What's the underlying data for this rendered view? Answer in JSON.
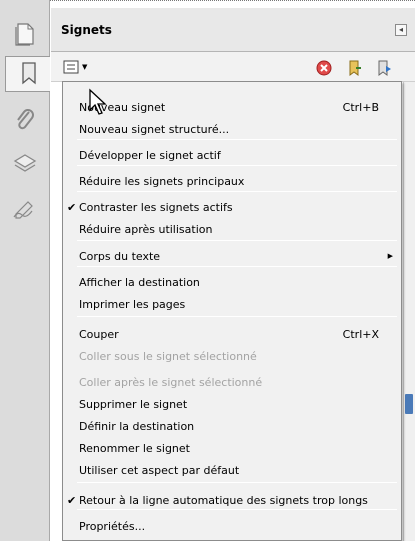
{
  "panel": {
    "title": "Signets"
  },
  "rail": {
    "icons": [
      "pages-icon",
      "bookmarks-icon",
      "attachments-icon",
      "layers-icon",
      "signatures-icon"
    ]
  },
  "toolbar": {
    "options_icon": "options-menu-icon",
    "delete_icon": "delete-icon",
    "new_bookmark_icon": "new-bookmark-icon",
    "expand_icon": "expand-bookmark-icon"
  },
  "menu": {
    "items": [
      {
        "label": "Nouveau signet",
        "shortcut": "Ctrl+B",
        "checked": false,
        "disabled": false,
        "submenu": false
      },
      {
        "label": "Nouveau signet structuré...",
        "shortcut": "",
        "checked": false,
        "disabled": false,
        "submenu": false
      },
      {
        "label": "Développer le signet actif",
        "shortcut": "",
        "checked": false,
        "disabled": false,
        "submenu": false
      },
      {
        "label": "Réduire les signets principaux",
        "shortcut": "",
        "checked": false,
        "disabled": false,
        "submenu": false
      },
      {
        "label": "Contraster les signets actifs",
        "shortcut": "",
        "checked": true,
        "disabled": false,
        "submenu": false
      },
      {
        "label": "Réduire après utilisation",
        "shortcut": "",
        "checked": false,
        "disabled": false,
        "submenu": false
      },
      {
        "label": "Corps du texte",
        "shortcut": "",
        "checked": false,
        "disabled": false,
        "submenu": true
      },
      {
        "label": "Afficher la destination",
        "shortcut": "",
        "checked": false,
        "disabled": false,
        "submenu": false
      },
      {
        "label": "Imprimer les pages",
        "shortcut": "",
        "checked": false,
        "disabled": false,
        "submenu": false
      },
      {
        "label": "Couper",
        "shortcut": "Ctrl+X",
        "checked": false,
        "disabled": false,
        "submenu": false
      },
      {
        "label": "Coller sous le signet sélectionné",
        "shortcut": "",
        "checked": false,
        "disabled": true,
        "submenu": false
      },
      {
        "label": "Coller après le signet sélectionné",
        "shortcut": "",
        "checked": false,
        "disabled": true,
        "submenu": false
      },
      {
        "label": "Supprimer le signet",
        "shortcut": "",
        "checked": false,
        "disabled": false,
        "submenu": false
      },
      {
        "label": "Définir la destination",
        "shortcut": "",
        "checked": false,
        "disabled": false,
        "submenu": false
      },
      {
        "label": "Renommer le signet",
        "shortcut": "",
        "checked": false,
        "disabled": false,
        "submenu": false
      },
      {
        "label": "Utiliser cet aspect par défaut",
        "shortcut": "",
        "checked": false,
        "disabled": false,
        "submenu": false
      },
      {
        "label": "Retour à la ligne automatique des signets trop longs",
        "shortcut": "",
        "checked": true,
        "disabled": false,
        "submenu": false
      },
      {
        "label": "Propriétés...",
        "shortcut": "",
        "checked": false,
        "disabled": false,
        "submenu": false
      }
    ],
    "check_glyph": "✔",
    "submenu_glyph": "▶"
  }
}
